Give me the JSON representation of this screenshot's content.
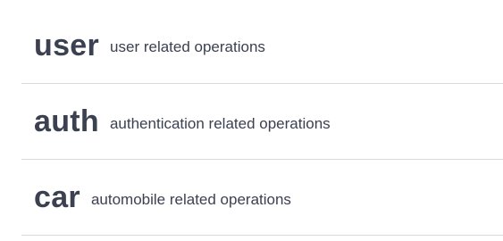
{
  "tag_groups": [
    {
      "name": "user",
      "description": "user related operations"
    },
    {
      "name": "auth",
      "description": "authentication related operations"
    },
    {
      "name": "car",
      "description": "automobile related operations"
    }
  ]
}
